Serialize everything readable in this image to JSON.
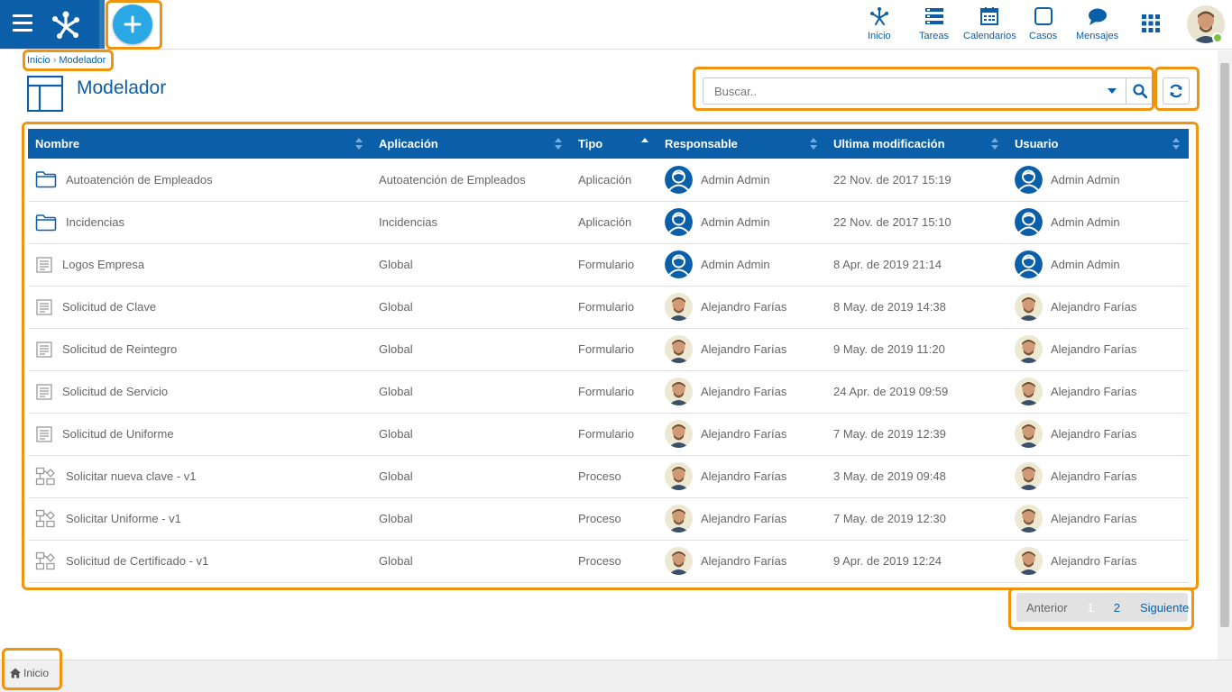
{
  "topbar": {
    "nav": [
      {
        "label": "Inicio",
        "icon": "network-icon"
      },
      {
        "label": "Tareas",
        "icon": "tasks-icon"
      },
      {
        "label": "Calendarios",
        "icon": "calendar-icon"
      },
      {
        "label": "Casos",
        "icon": "square-icon"
      },
      {
        "label": "Mensajes",
        "icon": "chat-icon"
      }
    ],
    "accent": "#0a5fa8",
    "add_color": "#2aa8e6"
  },
  "breadcrumb": {
    "home": "Inicio",
    "separator": "›",
    "current": "Modelador"
  },
  "page": {
    "title": "Modelador"
  },
  "search": {
    "placeholder": "Buscar.."
  },
  "table": {
    "headers": [
      "Nombre",
      "Aplicación",
      "Tipo",
      "Responsable",
      "Ultima modificación",
      "Usuario"
    ],
    "rows": [
      {
        "name": "Autoatención de Empleados",
        "icon": "folder",
        "app": "Autoatención de Empleados",
        "type": "Aplicación",
        "owner": "Admin Admin",
        "owner_avatar": "admin",
        "modified": "22 Nov. de 2017 15:19",
        "user": "Admin Admin",
        "user_avatar": "admin"
      },
      {
        "name": "Incidencias",
        "icon": "folder",
        "app": "Incidencias",
        "type": "Aplicación",
        "owner": "Admin Admin",
        "owner_avatar": "admin",
        "modified": "22 Nov. de 2017 15:10",
        "user": "Admin Admin",
        "user_avatar": "admin"
      },
      {
        "name": "Logos Empresa",
        "icon": "form",
        "app": "Global",
        "type": "Formulario",
        "owner": "Admin Admin",
        "owner_avatar": "admin",
        "modified": "8 Apr. de 2019 21:14",
        "user": "Admin Admin",
        "user_avatar": "admin"
      },
      {
        "name": "Solicitud de Clave",
        "icon": "form",
        "app": "Global",
        "type": "Formulario",
        "owner": "Alejandro Farías",
        "owner_avatar": "photo",
        "modified": "8 May. de 2019 14:38",
        "user": "Alejandro Farías",
        "user_avatar": "photo"
      },
      {
        "name": "Solicitud de Reintegro",
        "icon": "form",
        "app": "Global",
        "type": "Formulario",
        "owner": "Alejandro Farías",
        "owner_avatar": "photo",
        "modified": "9 May. de 2019 11:20",
        "user": "Alejandro Farías",
        "user_avatar": "photo"
      },
      {
        "name": "Solicitud de Servicio",
        "icon": "form",
        "app": "Global",
        "type": "Formulario",
        "owner": "Alejandro Farías",
        "owner_avatar": "photo",
        "modified": "24 Apr. de 2019 09:59",
        "user": "Alejandro Farías",
        "user_avatar": "photo"
      },
      {
        "name": "Solicitud de Uniforme",
        "icon": "form",
        "app": "Global",
        "type": "Formulario",
        "owner": "Alejandro Farías",
        "owner_avatar": "photo",
        "modified": "7 May. de 2019 12:39",
        "user": "Alejandro Farías",
        "user_avatar": "photo"
      },
      {
        "name": "Solicitar nueva clave - v1",
        "icon": "process",
        "app": "Global",
        "type": "Proceso",
        "owner": "Alejandro Farías",
        "owner_avatar": "photo",
        "modified": "3 May. de 2019 09:48",
        "user": "Alejandro Farías",
        "user_avatar": "photo"
      },
      {
        "name": "Solicitar Uniforme - v1",
        "icon": "process",
        "app": "Global",
        "type": "Proceso",
        "owner": "Alejandro Farías",
        "owner_avatar": "photo",
        "modified": "7 May. de 2019 12:30",
        "user": "Alejandro Farías",
        "user_avatar": "photo"
      },
      {
        "name": "Solicitud de Certificado - v1",
        "icon": "process",
        "app": "Global",
        "type": "Proceso",
        "owner": "Alejandro Farías",
        "owner_avatar": "photo",
        "modified": "9 Apr. de 2019 12:24",
        "user": "Alejandro Farías",
        "user_avatar": "photo"
      }
    ]
  },
  "pager": {
    "prev": "Anterior",
    "current": "1",
    "next_page": "2",
    "next": "Siguiente"
  },
  "footer": {
    "home_tab": "Inicio"
  },
  "highlight_color": "#f0940f"
}
